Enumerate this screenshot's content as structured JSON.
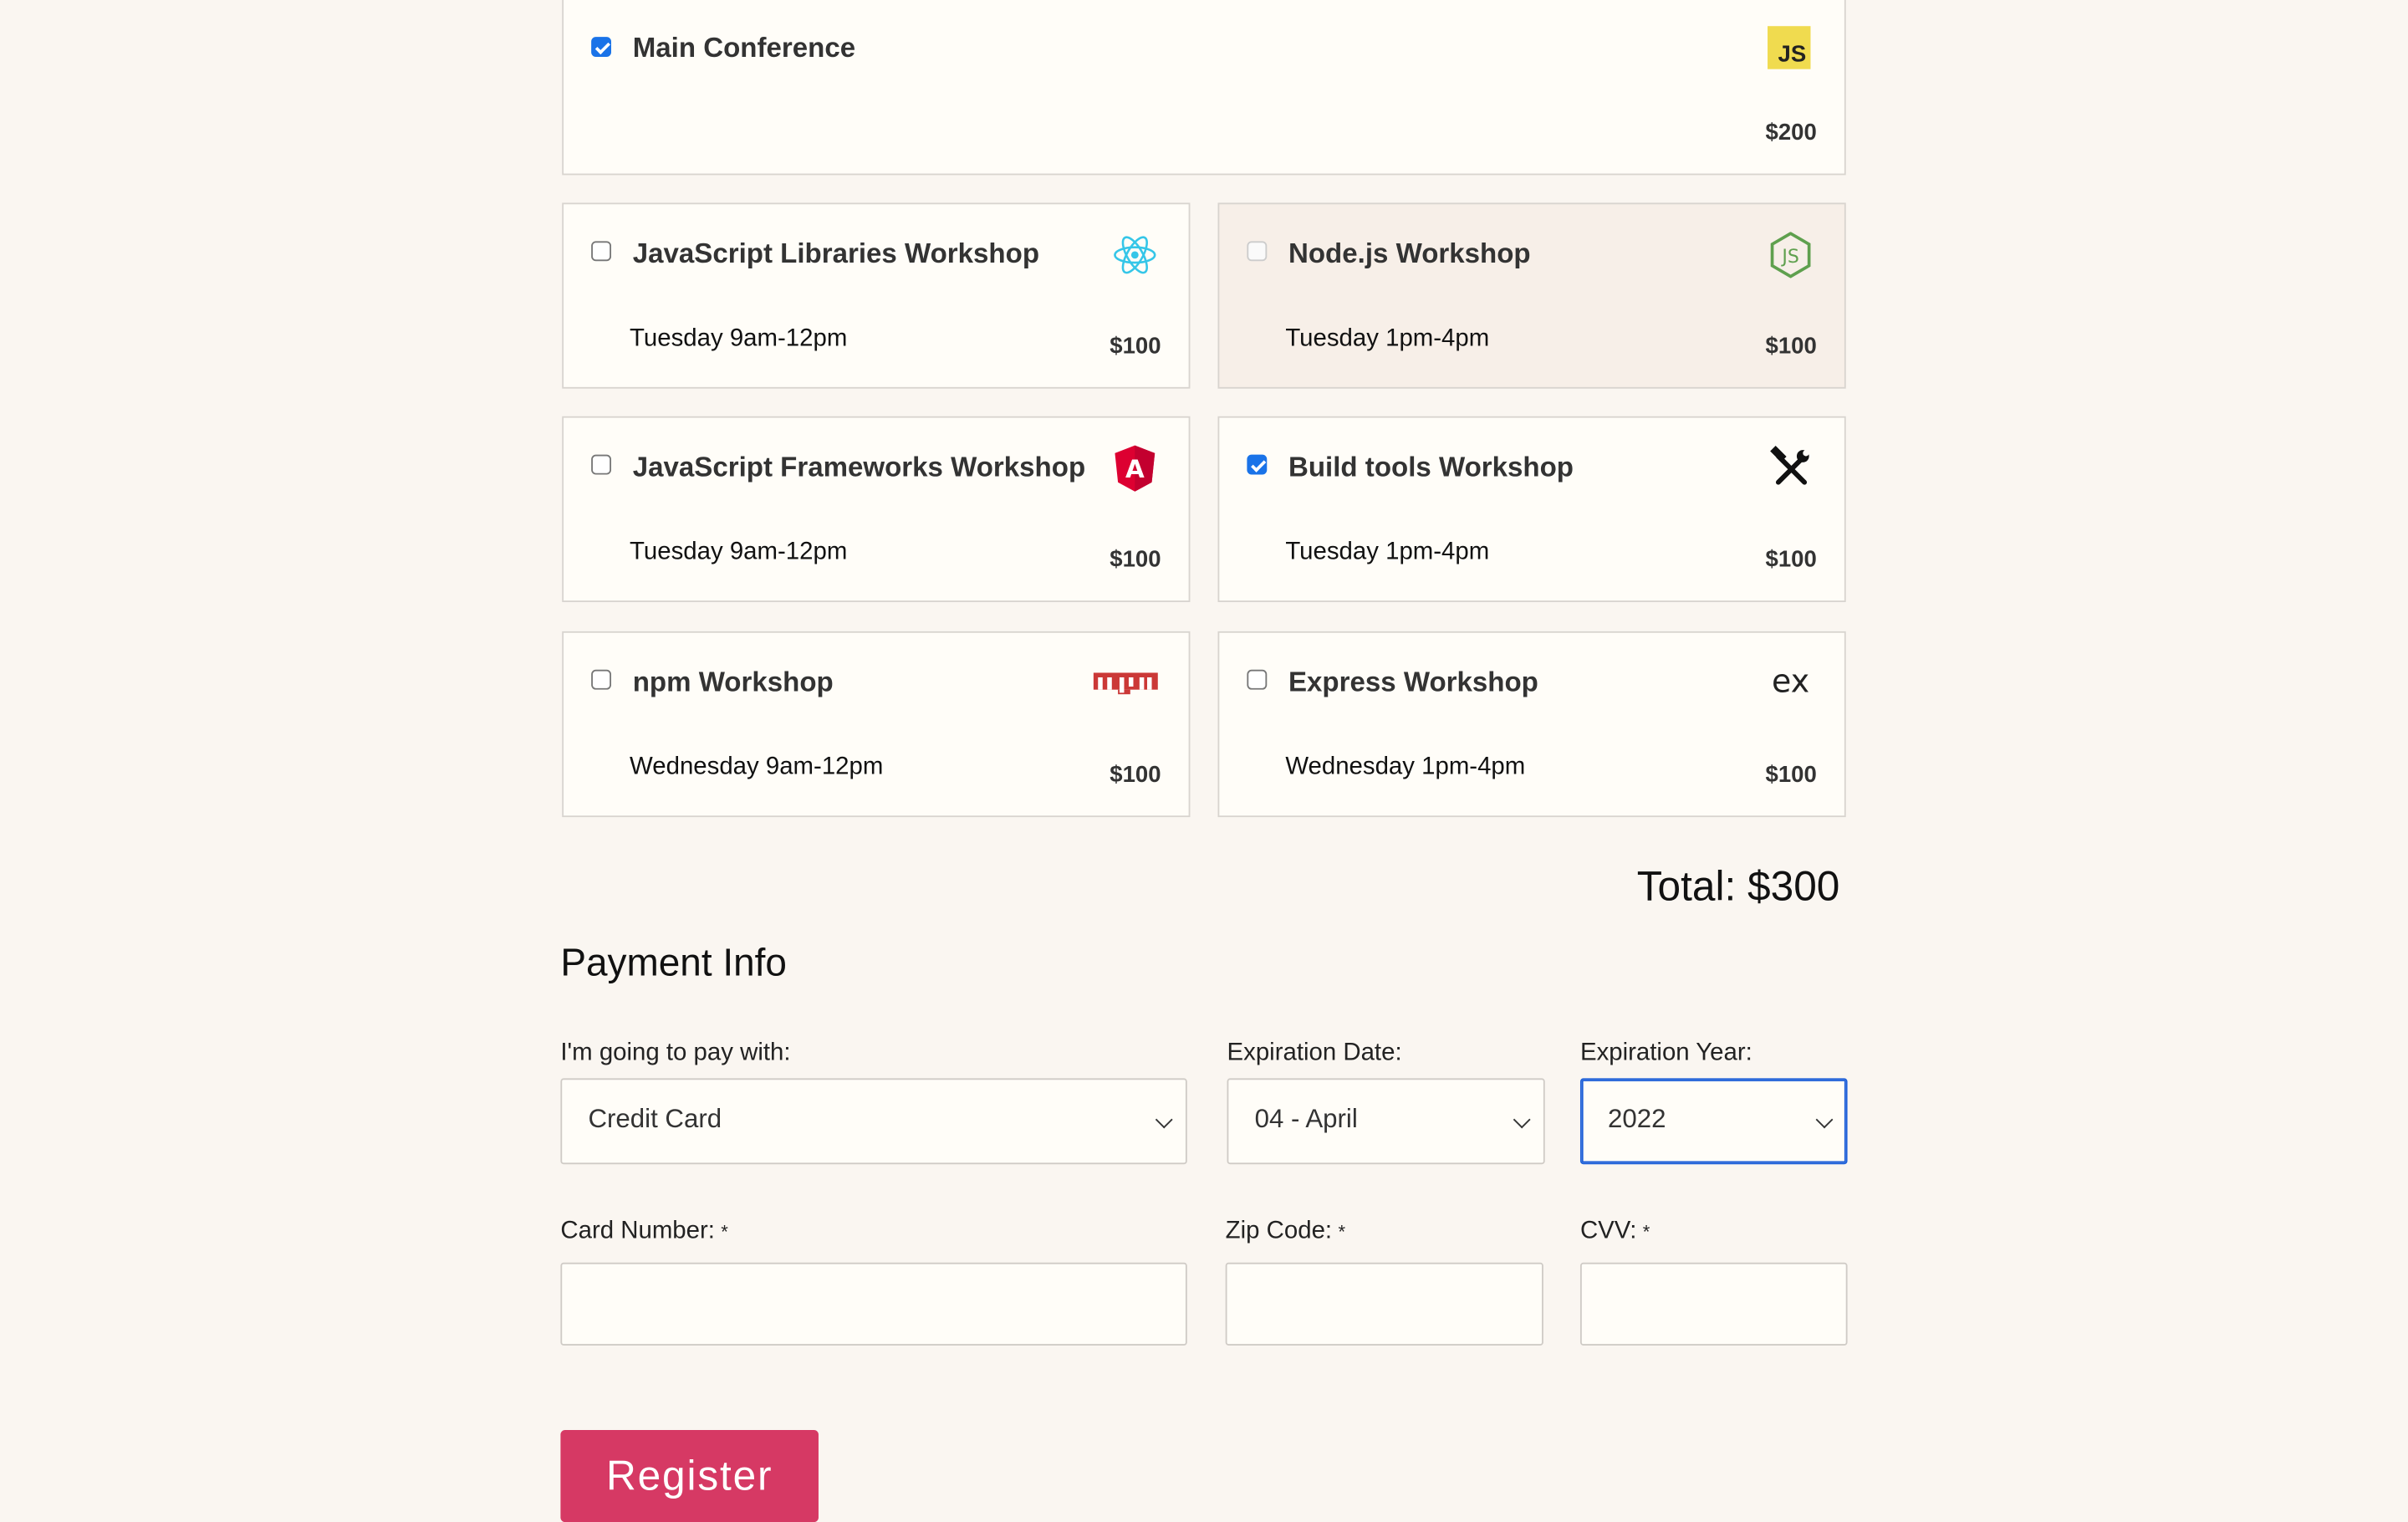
{
  "main_conference": {
    "name": "Main Conference",
    "price": "$200",
    "checked": true,
    "logo": "JS"
  },
  "activities": [
    {
      "name": "JavaScript Libraries Workshop",
      "when": "Tuesday 9am-12pm",
      "price": "$100",
      "icon": "react-icon"
    },
    {
      "name": "Node.js Workshop",
      "when": "Tuesday 1pm-4pm",
      "price": "$100",
      "icon": "nodejs-icon"
    },
    {
      "name": "JavaScript Frameworks Workshop",
      "when": "Tuesday 9am-12pm",
      "price": "$100",
      "icon": "angular-icon"
    },
    {
      "name": "Build tools Workshop",
      "when": "Tuesday 1pm-4pm",
      "price": "$100",
      "icon": "hammer-wrench-icon"
    },
    {
      "name": "npm Workshop",
      "when": "Wednesday 9am-12pm",
      "price": "$100",
      "icon": "npm-icon"
    },
    {
      "name": "Express Workshop",
      "when": "Wednesday 1pm-4pm",
      "price": "$100",
      "icon": "express-icon"
    }
  ],
  "total": "Total: $300",
  "payment": {
    "heading": "Payment Info",
    "method_label": "I'm going to pay with:",
    "method_value": "Credit Card",
    "exp_date_label": "Expiration Date:",
    "exp_date_value": "04 - April",
    "exp_year_label": "Expiration Year:",
    "exp_year_value": "2022",
    "card_label": "Card Number:",
    "zip_label": "Zip Code:",
    "cvv_label": "CVV:",
    "required_mark": "*"
  },
  "register_label": "Register",
  "colors": {
    "background": "#faf6f1",
    "accent": "#d63964",
    "check": "#1a73e8",
    "focus": "#1d5fd8"
  }
}
